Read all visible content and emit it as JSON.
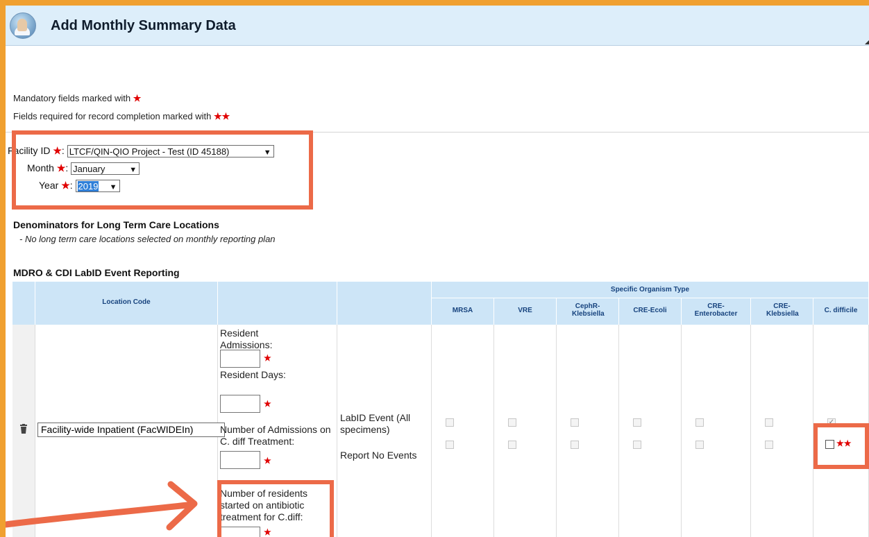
{
  "header": {
    "title": "Add Monthly Summary Data",
    "logo_icon": "clinician-icon"
  },
  "info": {
    "mandatory_text": "Mandatory fields marked with",
    "mandatory_star": "★",
    "completion_text": "Fields required for record completion marked with",
    "completion_star": "★★"
  },
  "facility": {
    "facility_label": "Facility ID",
    "facility_value": "LTCF/QIN-QIO Project - Test (ID 45188)",
    "month_label": "Month",
    "month_value": "January",
    "year_label": "Year",
    "year_value": "2019",
    "label_star": "★",
    "colon": ":"
  },
  "denominators": {
    "title": "Denominators for Long Term Care Locations",
    "note": "- No long term care locations selected on monthly reporting plan"
  },
  "mdro": {
    "title": "MDRO & CDI LabID Event Reporting",
    "location_code_header": "Location Code",
    "specific_organism_header": "Specific Organism Type",
    "organisms": [
      "MRSA",
      "VRE",
      "CephR-Klebsiella",
      "CRE-Ecoli",
      "CRE-Enterobacter",
      "CRE-Klebsiella",
      "C. difficile"
    ],
    "location_value": "Facility-wide Inpatient (FacWIDEIn)",
    "resident_admissions_label": "Resident Admissions:",
    "resident_days_label": "Resident Days:",
    "cdiff_admissions_label": "Number of Admissions on C. diff Treatment:",
    "antibiotic_label": "Number of residents started on antibiotic treatment for C.diff:",
    "labid_event_label": "LabID Event (All specimens)",
    "report_no_events_label": "Report No Events",
    "required_star": "★",
    "completion_star": "★★",
    "cdiff_labid_checked": true,
    "cdiff_no_events_checked": false
  },
  "colors": {
    "highlight": "#ec6a48",
    "frame": "#f0a030",
    "header_bg": "#ddeefa",
    "table_header_bg": "#cde5f7"
  }
}
